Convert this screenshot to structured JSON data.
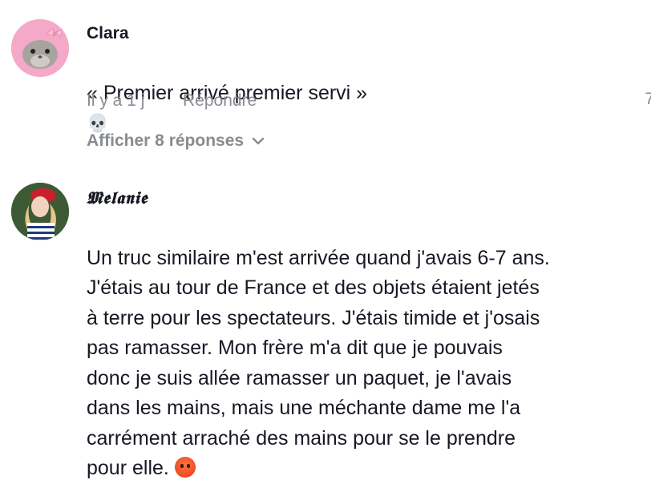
{
  "comments": [
    {
      "username": "Clara",
      "text": "« Premier arrivé premier servi »",
      "emoji": "💀",
      "time": "Il y a 1 j",
      "reply_label": "Répondre",
      "view_replies": "Afficher 8 réponses",
      "edge_text": "7"
    },
    {
      "username": "𝕸𝖊𝖑𝖆𝖓𝖎𝖊",
      "text": "Un truc similaire m'est arrivée quand j'avais 6-7 ans.\nJ'étais au tour de France et des objets étaient jetés\nà terre pour les spectateurs. J'étais timide et j'osais\npas ramasser. Mon frère m'a dit que je pouvais\ndonc je suis allée ramasser un paquet, je l'avais\ndans les mains, mais une méchante dame me l'a\ncarrément arraché des mains pour se le prendre\npour elle."
    }
  ]
}
